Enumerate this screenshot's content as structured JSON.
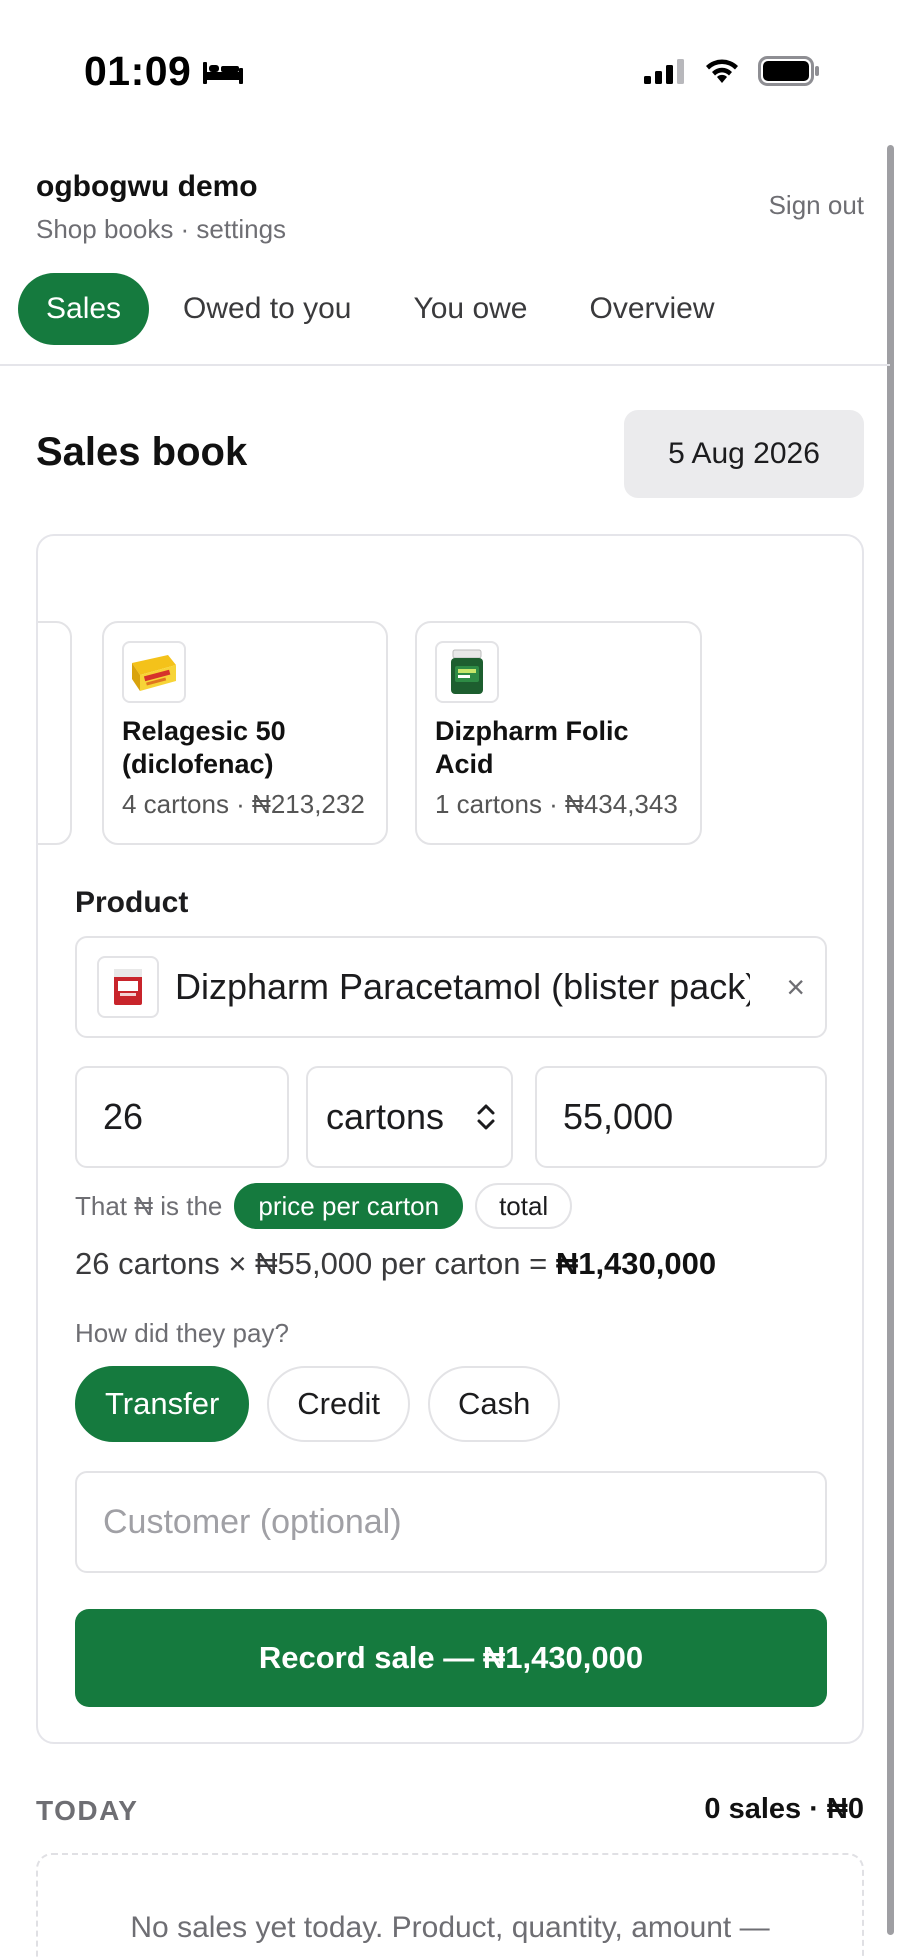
{
  "status_bar": {
    "time": "01:09"
  },
  "header": {
    "shop_name": "ogbogwu demo",
    "subtitle": "Shop books · settings",
    "sign_out": "Sign out"
  },
  "tabs": [
    {
      "label": "Sales",
      "active": true
    },
    {
      "label": "Owed to you",
      "active": false
    },
    {
      "label": "You owe",
      "active": false
    },
    {
      "label": "Overview",
      "active": false
    }
  ],
  "page": {
    "title": "Sales book",
    "date": "5 Aug 2026"
  },
  "quick_products": [
    {
      "name_line1": "Relagesic 50",
      "name_line2": "(diclofenac)",
      "meta": "4 cartons · ₦213,232"
    },
    {
      "name_line1": "Dizpharm Folic Acid",
      "name_line2": "",
      "meta": "1 cartons · ₦434,343"
    }
  ],
  "form": {
    "product_label": "Product",
    "product_value": "Dizpharm Paracetamol (blister pack)",
    "clear": "×",
    "quantity": "26",
    "unit": "cartons",
    "price": "55,000",
    "price_mode_prefix": "That ₦ is the",
    "price_mode_options": [
      "price per carton",
      "total"
    ],
    "formula_text": "26 cartons × ₦55,000 per carton = ",
    "formula_total": "₦1,430,000",
    "payment_label": "How did they pay?",
    "payment_options": [
      "Transfer",
      "Credit",
      "Cash"
    ],
    "customer_placeholder": "Customer (optional)",
    "submit_label": "Record sale — ₦1,430,000"
  },
  "today": {
    "label": "TODAY",
    "summary": "0 sales · ₦0",
    "empty_text": "No sales yet today. Product, quantity, amount —"
  },
  "colors": {
    "accent": "#157a3e",
    "muted": "#6e6e73",
    "border": "#e3e3e6"
  }
}
